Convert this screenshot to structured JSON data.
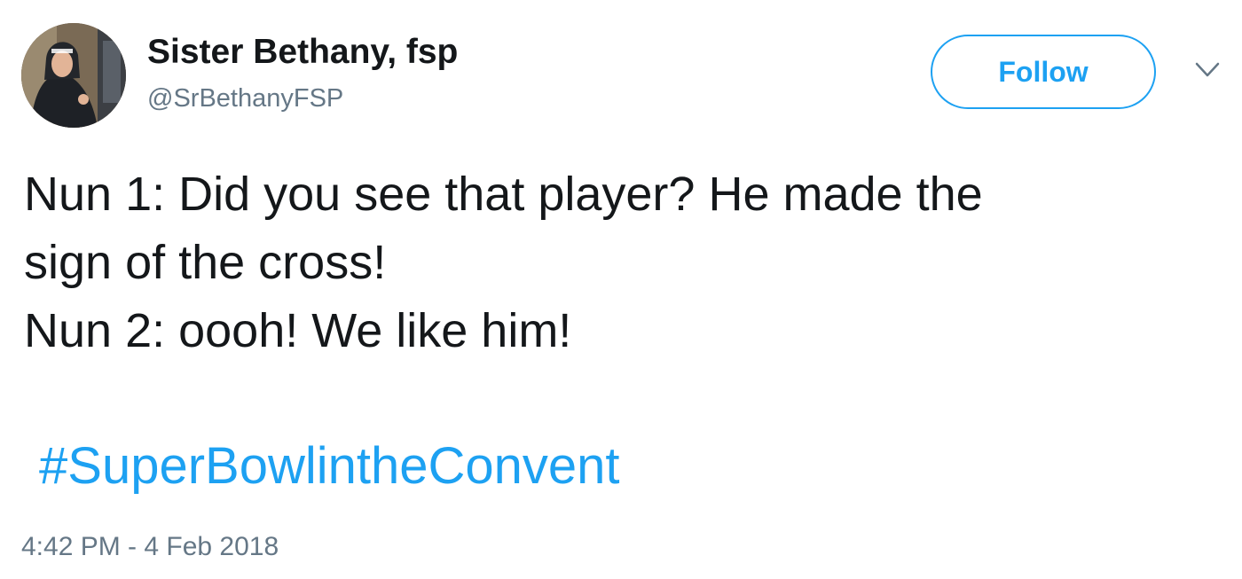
{
  "author": {
    "display_name": "Sister Bethany, fsp",
    "handle": "@SrBethanyFSP",
    "avatar_icon": "profile-photo"
  },
  "follow": {
    "label": "Follow"
  },
  "menu": {
    "icon": "chevron-down-icon"
  },
  "tweet": {
    "lines": [
      "Nun 1: Did you see that player? He made the",
      "sign of the cross!",
      "Nun 2: oooh! We like him!"
    ],
    "hashtag": "#SuperBowlintheConvent",
    "timestamp": "4:42 PM - 4 Feb 2018"
  },
  "colors": {
    "accent": "#1da1f2",
    "text": "#14171a",
    "secondary_text": "#657786",
    "background": "#ffffff"
  }
}
